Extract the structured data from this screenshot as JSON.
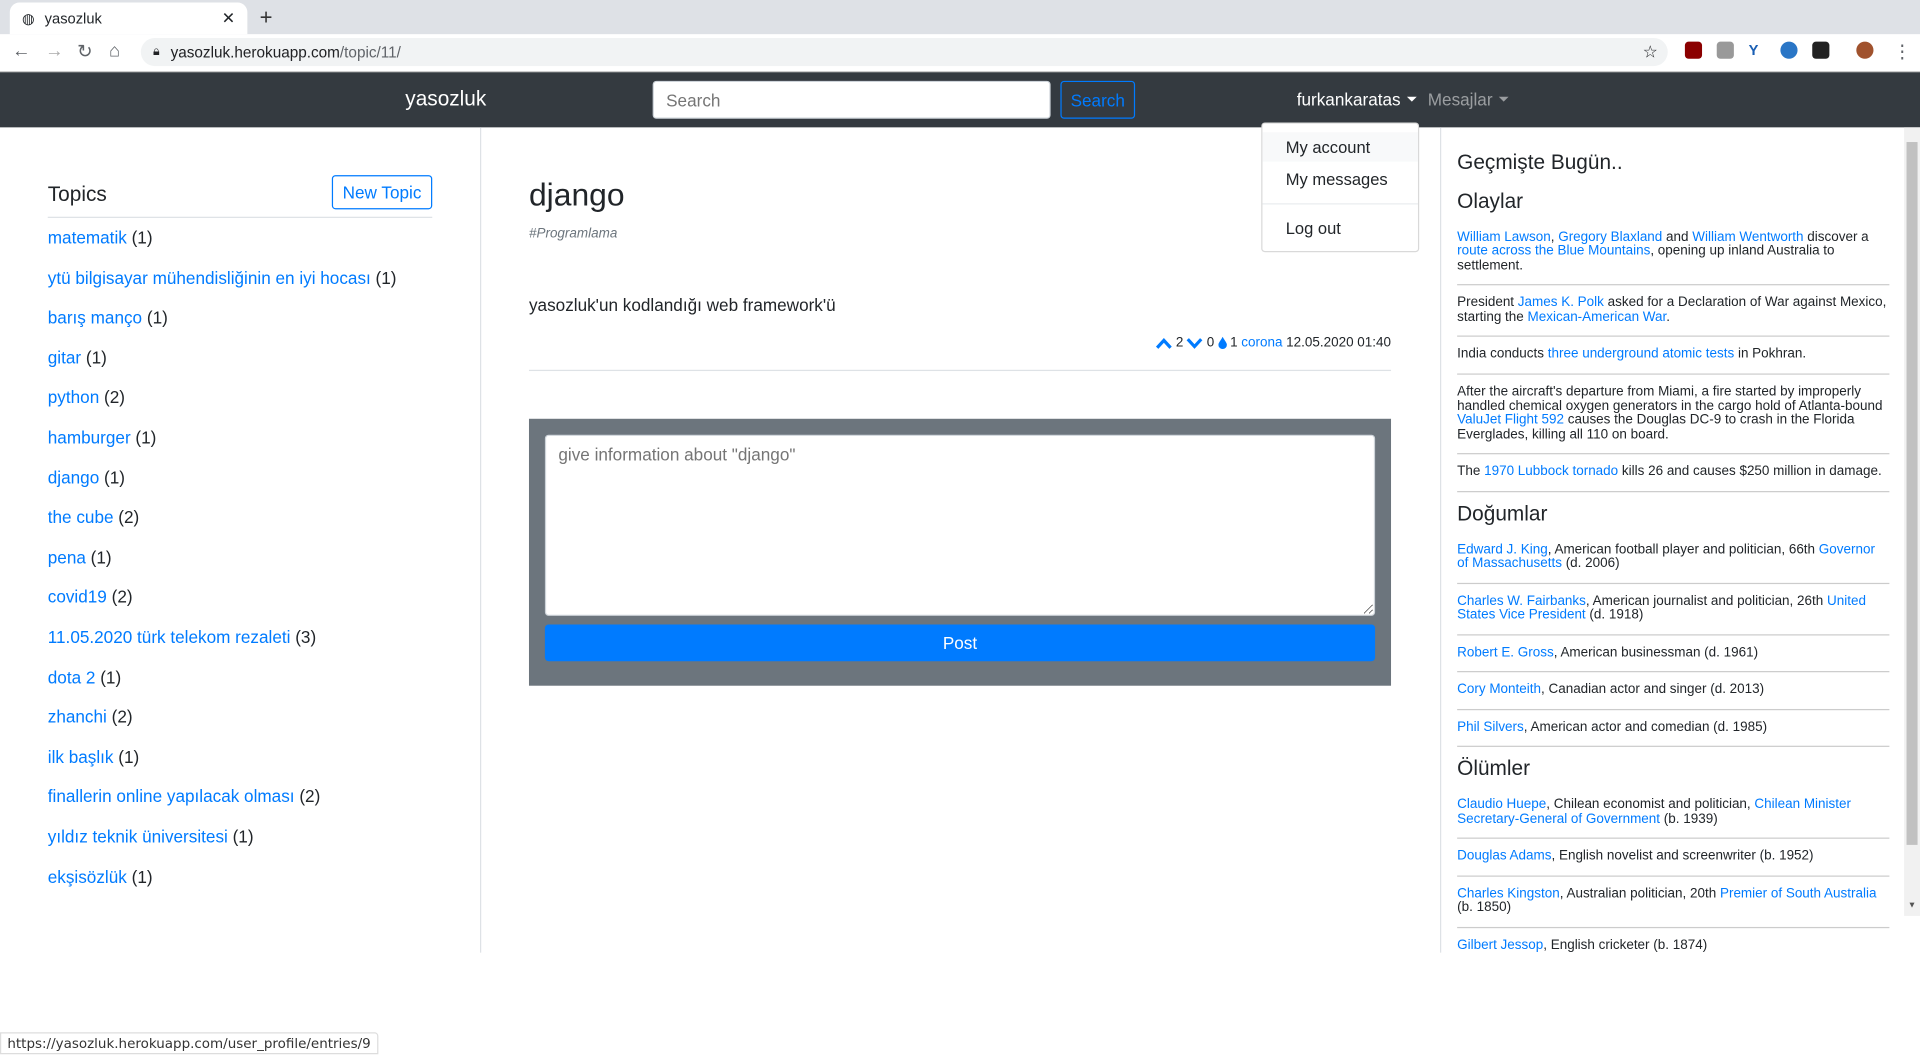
{
  "browser": {
    "tab_title": "yasozluk",
    "url_host": "yasozluk.herokuapp.com",
    "url_path": "/topic/11/",
    "status_url": "https://yasozluk.herokuapp.com/user_profile/entries/9"
  },
  "navbar": {
    "brand": "yasozluk",
    "search_placeholder": "Search",
    "search_button": "Search",
    "user": "furkankaratas",
    "messages": "Mesajlar"
  },
  "dropdown": {
    "items": [
      "My account",
      "My messages",
      "Log out"
    ]
  },
  "sidebar": {
    "title": "Topics",
    "new_topic": "New Topic",
    "topics": [
      {
        "name": "matematik",
        "count": "(1)"
      },
      {
        "name": "ytü bilgisayar mühendisliğinin en iyi hocası",
        "count": "(1)"
      },
      {
        "name": "barış manço",
        "count": "(1)"
      },
      {
        "name": "gitar",
        "count": "(1)"
      },
      {
        "name": "python",
        "count": "(2)"
      },
      {
        "name": "hamburger",
        "count": "(1)"
      },
      {
        "name": "django",
        "count": "(1)"
      },
      {
        "name": "the cube",
        "count": "(2)"
      },
      {
        "name": "pena",
        "count": "(1)"
      },
      {
        "name": "covid19",
        "count": "(2)"
      },
      {
        "name": "11.05.2020 türk telekom rezaleti",
        "count": "(3)"
      },
      {
        "name": "dota 2",
        "count": "(1)"
      },
      {
        "name": "zhanchi",
        "count": "(2)"
      },
      {
        "name": "ilk başlık",
        "count": "(1)"
      },
      {
        "name": "finallerin online yapılacak olması",
        "count": "(2)"
      },
      {
        "name": "yıldız teknik üniversitesi",
        "count": "(1)"
      },
      {
        "name": "ekşisözlük",
        "count": "(1)"
      }
    ]
  },
  "topic": {
    "title": "django",
    "tag": "#Programlama",
    "entry": {
      "text": "yasozluk'un kodlandığı web framework'ü",
      "upvotes": "2",
      "downvotes": "0",
      "drops": "1",
      "author": "corona",
      "date": "12.05.2020 01:40"
    },
    "textarea_placeholder": "give information about \"django\"",
    "post_button": "Post"
  },
  "history": {
    "title": "Geçmişte Bugün..",
    "sections": [
      {
        "heading": "Olaylar",
        "items": [
          [
            {
              "t": "William Lawson",
              "l": 1
            },
            {
              "t": ", "
            },
            {
              "t": "Gregory Blaxland",
              "l": 1
            },
            {
              "t": " and "
            },
            {
              "t": "William Wentworth",
              "l": 1
            },
            {
              "t": " discover a "
            },
            {
              "t": "route across the Blue Mountains",
              "l": 1
            },
            {
              "t": ", opening up inland Australia to settlement."
            }
          ],
          [
            {
              "t": "President "
            },
            {
              "t": "James K. Polk",
              "l": 1
            },
            {
              "t": " asked for a Declaration of War against Mexico, starting the "
            },
            {
              "t": "Mexican-American War",
              "l": 1
            },
            {
              "t": "."
            }
          ],
          [
            {
              "t": "India conducts "
            },
            {
              "t": "three underground atomic tests",
              "l": 1
            },
            {
              "t": " in Pokhran."
            }
          ],
          [
            {
              "t": "After the aircraft's departure from Miami, a fire started by improperly handled chemical oxygen generators in the cargo hold of Atlanta-bound "
            },
            {
              "t": "ValuJet Flight 592",
              "l": 1
            },
            {
              "t": " causes the Douglas DC-9 to crash in the Florida Everglades, killing all 110 on board."
            }
          ],
          [
            {
              "t": "The "
            },
            {
              "t": "1970 Lubbock tornado",
              "l": 1
            },
            {
              "t": " kills 26 and causes $250 million in damage."
            }
          ]
        ]
      },
      {
        "heading": "Doğumlar",
        "items": [
          [
            {
              "t": "Edward J. King",
              "l": 1
            },
            {
              "t": ", American football player and politician, 66th "
            },
            {
              "t": "Governor of Massachusetts",
              "l": 1
            },
            {
              "t": " (d. 2006)"
            }
          ],
          [
            {
              "t": "Charles W. Fairbanks",
              "l": 1
            },
            {
              "t": ", American journalist and politician, 26th "
            },
            {
              "t": "United States Vice President",
              "l": 1
            },
            {
              "t": " (d. 1918)"
            }
          ],
          [
            {
              "t": "Robert E. Gross",
              "l": 1
            },
            {
              "t": ", American businessman (d. 1961)"
            }
          ],
          [
            {
              "t": "Cory Monteith",
              "l": 1
            },
            {
              "t": ", Canadian actor and singer (d. 2013)"
            }
          ],
          [
            {
              "t": "Phil Silvers",
              "l": 1
            },
            {
              "t": ", American actor and comedian (d. 1985)"
            }
          ]
        ]
      },
      {
        "heading": "Ölümler",
        "items": [
          [
            {
              "t": "Claudio Huepe",
              "l": 1
            },
            {
              "t": ", Chilean economist and politician, "
            },
            {
              "t": "Chilean Minister Secretary-General of Government",
              "l": 1
            },
            {
              "t": " (b. 1939)"
            }
          ],
          [
            {
              "t": "Douglas Adams",
              "l": 1
            },
            {
              "t": ", English novelist and screenwriter (b. 1952)"
            }
          ],
          [
            {
              "t": "Charles Kingston",
              "l": 1
            },
            {
              "t": ", Australian politician, 20th "
            },
            {
              "t": "Premier of South Australia",
              "l": 1
            },
            {
              "t": " (b. 1850)"
            }
          ],
          [
            {
              "t": "Gilbert Jessop",
              "l": 1
            },
            {
              "t": ", English cricketer (b. 1874)"
            }
          ]
        ]
      }
    ]
  },
  "colors": {
    "primary": "#007bff",
    "navbar": "#343a40",
    "form_box": "#6c757d"
  }
}
